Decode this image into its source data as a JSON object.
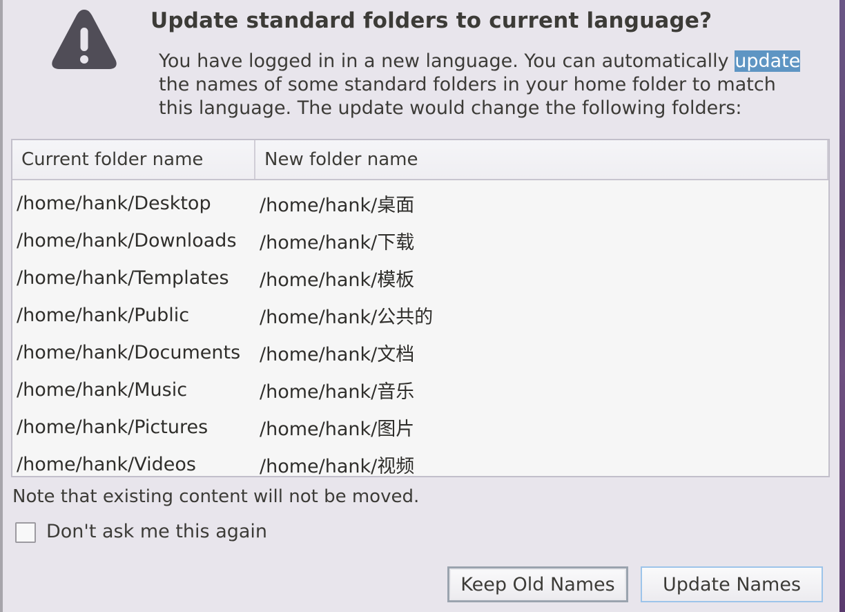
{
  "dialog": {
    "title": "Update standard folders to current language?",
    "message_lines": [
      "You have logged in in a new language. You can automatically ",
      "the names of some standard folders in your home folder to match",
      "this language. The update would change the following folders:"
    ],
    "message_selected_word": "update",
    "icon": "warning-icon"
  },
  "table": {
    "columns": [
      "Current folder name",
      "New folder name"
    ],
    "rows": [
      {
        "current": "/home/hank/Desktop",
        "new": "/home/hank/桌面"
      },
      {
        "current": "/home/hank/Downloads",
        "new": "/home/hank/下载"
      },
      {
        "current": "/home/hank/Templates",
        "new": "/home/hank/模板"
      },
      {
        "current": "/home/hank/Public",
        "new": "/home/hank/公共的"
      },
      {
        "current": "/home/hank/Documents",
        "new": "/home/hank/文档"
      },
      {
        "current": "/home/hank/Music",
        "new": "/home/hank/音乐"
      },
      {
        "current": "/home/hank/Pictures",
        "new": "/home/hank/图片"
      },
      {
        "current": "/home/hank/Videos",
        "new": "/home/hank/视频"
      }
    ]
  },
  "note": "Note that existing content will not be moved.",
  "dont_ask": {
    "label": "Don't ask me this again",
    "checked": false
  },
  "buttons": {
    "keep": "Keep Old Names",
    "update": "Update Names"
  },
  "colors": {
    "selection": "#5e95c3",
    "background": "#e8e5ec",
    "text": "#3c3b37",
    "default_button_border": "#9cc4ea"
  }
}
